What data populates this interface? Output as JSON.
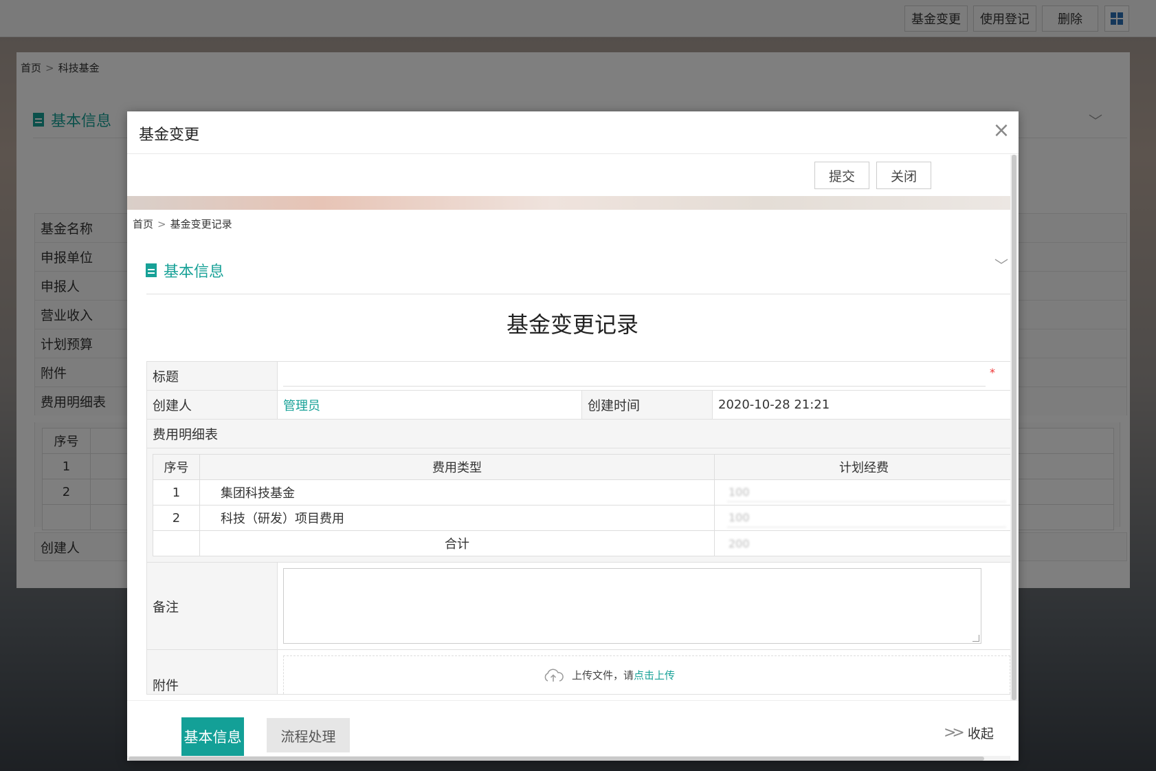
{
  "topbar": {
    "buttons": [
      "基金变更",
      "使用登记",
      "删除"
    ],
    "grid_icon": "grid-icon"
  },
  "background": {
    "breadcrumb": [
      "首页",
      "科技基金"
    ],
    "section_title": "基本信息",
    "fields": [
      "基金名称",
      "申报单位",
      "申报人",
      "营业收入",
      "计划预算",
      "附件",
      "费用明细表"
    ],
    "inner_table": {
      "header": "序号",
      "rows": [
        "1",
        "2",
        ""
      ]
    },
    "creator_label": "创建人"
  },
  "modal": {
    "title": "基金变更",
    "close_icon": "close-icon",
    "toolbar": {
      "submit": "提交",
      "close": "关闭"
    },
    "breadcrumb": [
      "首页",
      "基金变更记录"
    ],
    "section_title": "基本信息",
    "form_title": "基金变更记录",
    "fields": {
      "title_label": "标题",
      "title_value": "",
      "required_mark": "*",
      "creator_label": "创建人",
      "creator_value": "管理员",
      "created_time_label": "创建时间",
      "created_time_value": "2020-10-28 21:21",
      "detail_label": "费用明细表",
      "note_label": "备注",
      "note_value": "",
      "attachment_label": "附件"
    },
    "detail_table": {
      "headers": [
        "序号",
        "费用类型",
        "计划经费"
      ],
      "rows": [
        {
          "no": "1",
          "type": "集团科技基金",
          "amount": "100"
        },
        {
          "no": "2",
          "type": "科技（研发）项目费用",
          "amount": "100"
        }
      ],
      "total_label": "合计",
      "total_value": "200"
    },
    "upload": {
      "text": "上传文件，请",
      "link": "点击上传",
      "icon": "cloud-upload-icon"
    },
    "tabs": [
      "基本信息",
      "流程处理"
    ],
    "collapse": "收起",
    "colors": {
      "accent": "#13a097",
      "required": "#e33333"
    }
  }
}
